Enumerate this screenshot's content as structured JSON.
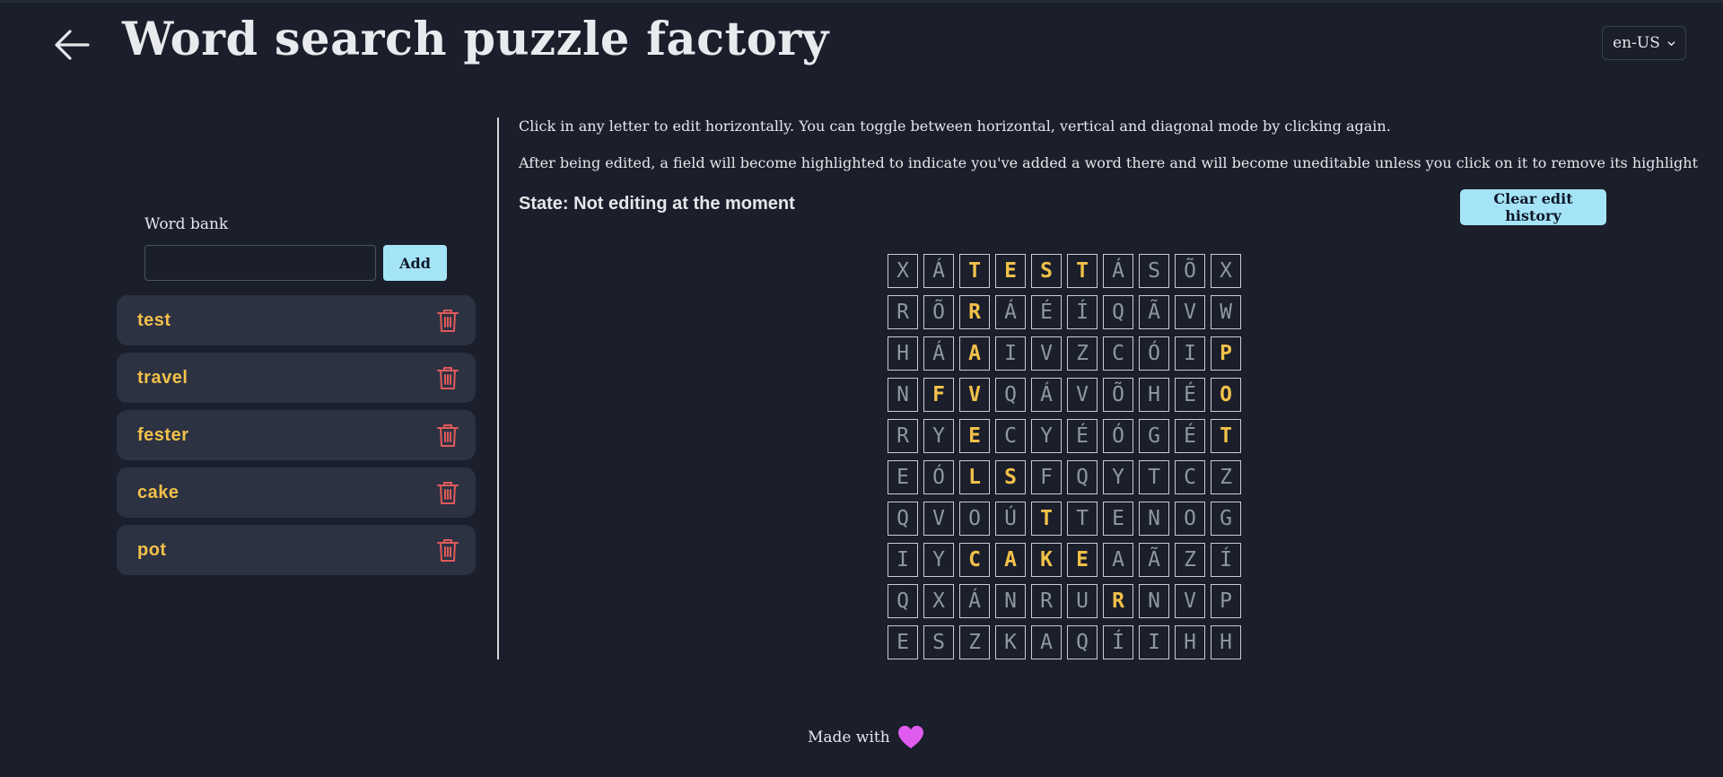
{
  "header": {
    "back_icon": "arrow-left-icon",
    "title": "Word search puzzle factory",
    "language": "en-US"
  },
  "word_bank": {
    "label": "Word bank",
    "input_value": "",
    "add_label": "Add",
    "words": [
      "test",
      "travel",
      "fester",
      "cake",
      "pot"
    ],
    "delete_icon": "trash-icon"
  },
  "instructions": {
    "line1": "Click in any letter to edit horizontally. You can toggle between horizontal, vertical and diagonal mode by clicking again.",
    "line2": "After being edited, a field will become highlighted to indicate you've added a word there and will become uneditable unless you click on it to remove its highlight"
  },
  "state_text": "State: Not editing at the moment",
  "clear_label": "Clear edit history",
  "grid": [
    [
      "X",
      "Á",
      "T",
      "E",
      "S",
      "T",
      "Á",
      "S",
      "Õ",
      "X"
    ],
    [
      "R",
      "Õ",
      "R",
      "Á",
      "É",
      "Í",
      "Q",
      "Ã",
      "V",
      "W"
    ],
    [
      "H",
      "Á",
      "A",
      "I",
      "V",
      "Z",
      "C",
      "Ó",
      "I",
      "P"
    ],
    [
      "N",
      "F",
      "V",
      "Q",
      "Á",
      "V",
      "Õ",
      "H",
      "É",
      "O"
    ],
    [
      "R",
      "Y",
      "E",
      "C",
      "Y",
      "É",
      "Ó",
      "G",
      "É",
      "T"
    ],
    [
      "E",
      "Ó",
      "L",
      "S",
      "F",
      "Q",
      "Y",
      "T",
      "C",
      "Z"
    ],
    [
      "Q",
      "V",
      "O",
      "Ú",
      "T",
      "T",
      "E",
      "N",
      "O",
      "G"
    ],
    [
      "I",
      "Y",
      "C",
      "A",
      "K",
      "E",
      "A",
      "Ã",
      "Z",
      "Í"
    ],
    [
      "Q",
      "X",
      "Á",
      "N",
      "R",
      "U",
      "R",
      "N",
      "V",
      "P"
    ],
    [
      "E",
      "S",
      "Z",
      "K",
      "A",
      "Q",
      "Í",
      "I",
      "H",
      "H"
    ]
  ],
  "highlighted": [
    [
      0,
      2
    ],
    [
      0,
      3
    ],
    [
      0,
      4
    ],
    [
      0,
      5
    ],
    [
      1,
      2
    ],
    [
      2,
      2
    ],
    [
      3,
      2
    ],
    [
      4,
      2
    ],
    [
      5,
      2
    ],
    [
      2,
      9
    ],
    [
      3,
      9
    ],
    [
      4,
      9
    ],
    [
      3,
      1
    ],
    [
      4,
      2
    ],
    [
      5,
      3
    ],
    [
      6,
      4
    ],
    [
      7,
      5
    ],
    [
      8,
      6
    ],
    [
      7,
      2
    ],
    [
      7,
      3
    ],
    [
      7,
      4
    ],
    [
      7,
      5
    ]
  ],
  "colors": {
    "highlight": "#f2c14a",
    "accent": "#a5e4f7",
    "danger": "#e05a5a",
    "heart": "#e05cf0"
  },
  "footer": {
    "text": "Made with",
    "icon": "heart-icon"
  }
}
